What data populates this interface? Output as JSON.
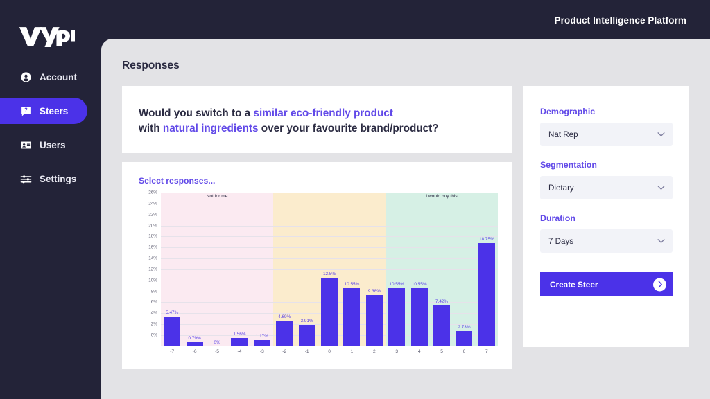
{
  "header": {
    "title": "Product Intelligence Platform"
  },
  "brand": {
    "logo_text": "vypr",
    "accent": "#4b32e8",
    "accent_text": "#6149e8",
    "sidebar_bg": "#232338",
    "panel_bg": "#e3e3e6",
    "card_bg": "#ffffff",
    "bar_color": "#4b32e8"
  },
  "sidebar": {
    "items": [
      {
        "label": "Account",
        "icon": "account-circle-icon",
        "active": false
      },
      {
        "label": "Steers",
        "icon": "speech-bubble-question-icon",
        "active": true
      },
      {
        "label": "Users",
        "icon": "id-card-icon",
        "active": false
      },
      {
        "label": "Settings",
        "icon": "sliders-icon",
        "active": false
      }
    ]
  },
  "main": {
    "page_title": "Responses",
    "question": {
      "segments": [
        {
          "text": "Would you switch to a ",
          "highlight": false
        },
        {
          "text": "similar eco-friendly product",
          "highlight": true
        },
        {
          "text": " with ",
          "highlight": false
        },
        {
          "text": "natural ingredients",
          "highlight": true
        },
        {
          "text": " over your favourite brand/product?",
          "highlight": false
        }
      ],
      "line1_plain": "Would you switch to a ",
      "line1_hl": "similar eco-friendly product",
      "line2_plain_a": "with ",
      "line2_hl": "natural ingredients",
      "line2_plain_b": " over your favourite brand/product?"
    },
    "chart_card_label": "Select responses..."
  },
  "controls": {
    "groups": [
      {
        "label": "Demographic",
        "value": "Nat Rep",
        "icon": "chevron-down-icon"
      },
      {
        "label": "Segmentation",
        "value": "Dietary",
        "icon": "chevron-down-icon"
      },
      {
        "label": "Duration",
        "value": "7 Days",
        "icon": "chevron-down-icon"
      }
    ],
    "create_button": {
      "label": "Create Steer",
      "icon": "chevron-right-icon"
    }
  },
  "chart_data": {
    "type": "bar",
    "title": "Select responses...",
    "xlabel": "",
    "ylabel": "",
    "ylim": [
      0,
      26
    ],
    "ytick_step": 2,
    "grid": true,
    "legend_position": "none",
    "categories": [
      "-7",
      "-6",
      "-5",
      "-4",
      "-3",
      "-2",
      "-1",
      "0",
      "1",
      "2",
      "3",
      "4",
      "5",
      "6",
      "7"
    ],
    "values": [
      5.47,
      0.79,
      0,
      1.56,
      1.17,
      4.69,
      3.91,
      12.5,
      10.55,
      9.38,
      10.55,
      10.55,
      7.42,
      2.73,
      18.75
    ],
    "value_labels": [
      "5.47%",
      "0.79%",
      "0%",
      "1.56%",
      "1.17%",
      "4.69%",
      "3.91%",
      "12.5%",
      "10.55%",
      "9.38%",
      "10.55%",
      "10.55%",
      "7.42%",
      "2.73%",
      "18.75%"
    ],
    "ytick_labels": [
      "0%",
      "2%",
      "4%",
      "6%",
      "8%",
      "10%",
      "12%",
      "14%",
      "16%",
      "18%",
      "20%",
      "22%",
      "24%",
      "26%"
    ],
    "regions": [
      {
        "label": "Not for me",
        "from": "-7",
        "to": "-3",
        "color": "#fbeaf1"
      },
      {
        "label": "",
        "from": "-2",
        "to": "2",
        "color": "#fbeccd"
      },
      {
        "label": "I would buy this",
        "from": "3",
        "to": "7",
        "color": "#d6f0e5"
      }
    ]
  }
}
